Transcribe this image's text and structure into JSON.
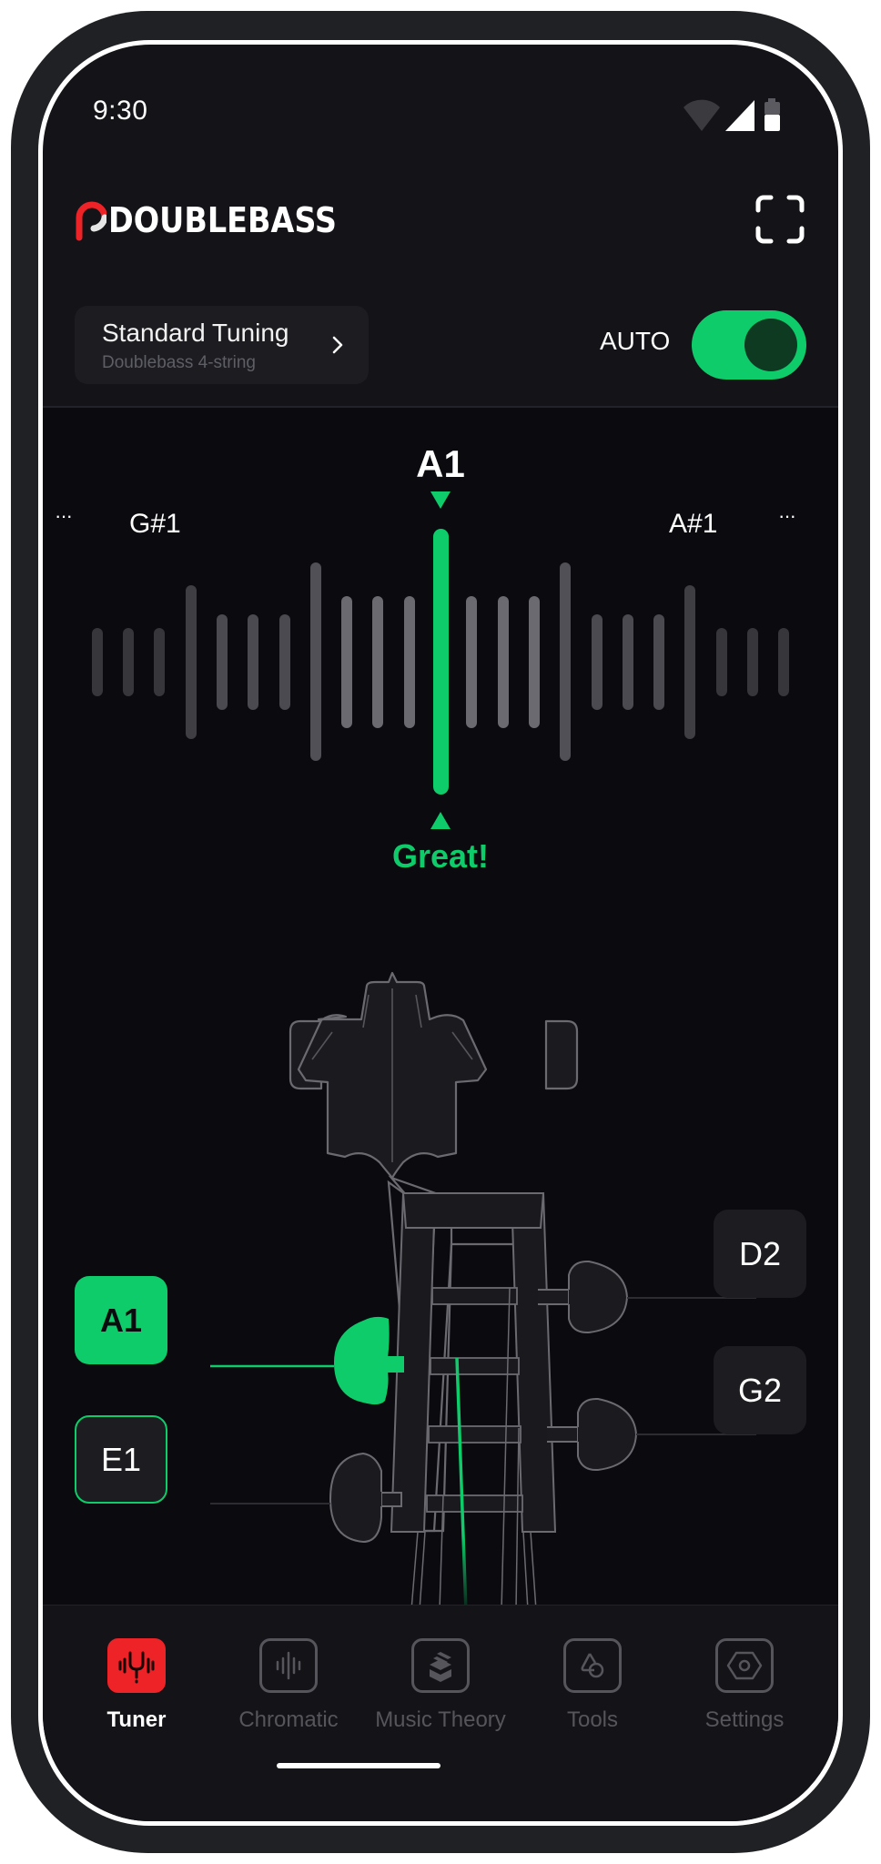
{
  "status_bar": {
    "time": "9:30",
    "icons": [
      "wifi-icon",
      "signal-icon",
      "battery-icon"
    ]
  },
  "header": {
    "app_name": "DOUBLEBASS",
    "brand_color": "#ee2328",
    "fullscreen_icon": "fullscreen-icon"
  },
  "tuning": {
    "title": "Standard Tuning",
    "subtitle": "Doublebass 4-string",
    "auto_label": "AUTO",
    "auto_enabled": true
  },
  "tuner": {
    "current_note": "A1",
    "prev_note": "G#1",
    "next_note": "A#1",
    "more_left": "···",
    "more_right": "···",
    "status": "Great!",
    "accent_color": "#0fcc6a",
    "deviation_cents": 0
  },
  "strings": [
    {
      "note": "A1",
      "state": "active",
      "side": "left"
    },
    {
      "note": "E1",
      "state": "ring",
      "side": "left"
    },
    {
      "note": "D2",
      "state": "plain",
      "side": "right"
    },
    {
      "note": "G2",
      "state": "plain",
      "side": "right"
    }
  ],
  "nav": {
    "items": [
      {
        "label": "Tuner",
        "icon": "tuning-fork-icon",
        "active": true
      },
      {
        "label": "Chromatic",
        "icon": "waveform-icon",
        "active": false
      },
      {
        "label": "Music Theory",
        "icon": "book-stack-icon",
        "active": false
      },
      {
        "label": "Tools",
        "icon": "shapes-icon",
        "active": false
      },
      {
        "label": "Settings",
        "icon": "hex-nut-icon",
        "active": false
      }
    ]
  }
}
